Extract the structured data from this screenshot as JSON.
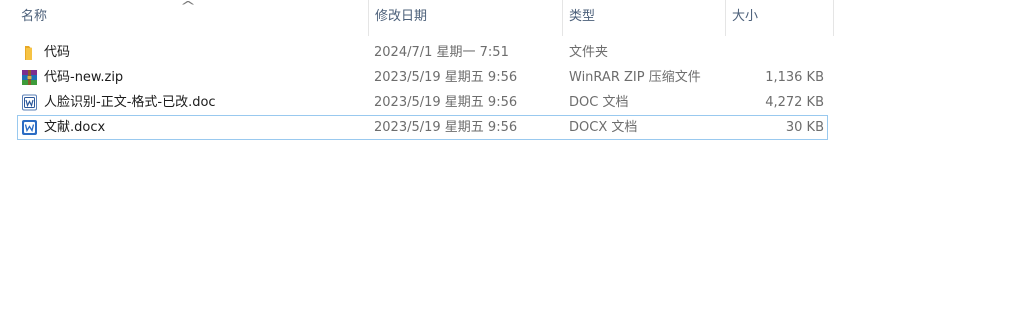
{
  "columns": {
    "name": "名称",
    "date_modified": "修改日期",
    "type": "类型",
    "size": "大小"
  },
  "files": [
    {
      "icon": "folder-icon",
      "name": "代码",
      "date": "2024/7/1 星期一 7:51",
      "type": "文件夹",
      "size": ""
    },
    {
      "icon": "winrar-archive-icon",
      "name": "代码-new.zip",
      "date": "2023/5/19 星期五 9:56",
      "type": "WinRAR ZIP 压缩文件",
      "size": "1,136 KB"
    },
    {
      "icon": "word-document-icon",
      "name": "人脸识别-正文-格式-已改.doc",
      "date": "2023/5/19 星期五 9:56",
      "type": "DOC 文档",
      "size": "4,272 KB"
    },
    {
      "icon": "word-document-icon",
      "name": "文献.docx",
      "date": "2023/5/19 星期五 9:56",
      "type": "DOCX 文档",
      "size": "30 KB"
    }
  ],
  "colors": {
    "header_text": "#4c607a",
    "folder": "#f6c344",
    "word_blue": "#2b579a",
    "selection_outline": "#99c9ef"
  }
}
